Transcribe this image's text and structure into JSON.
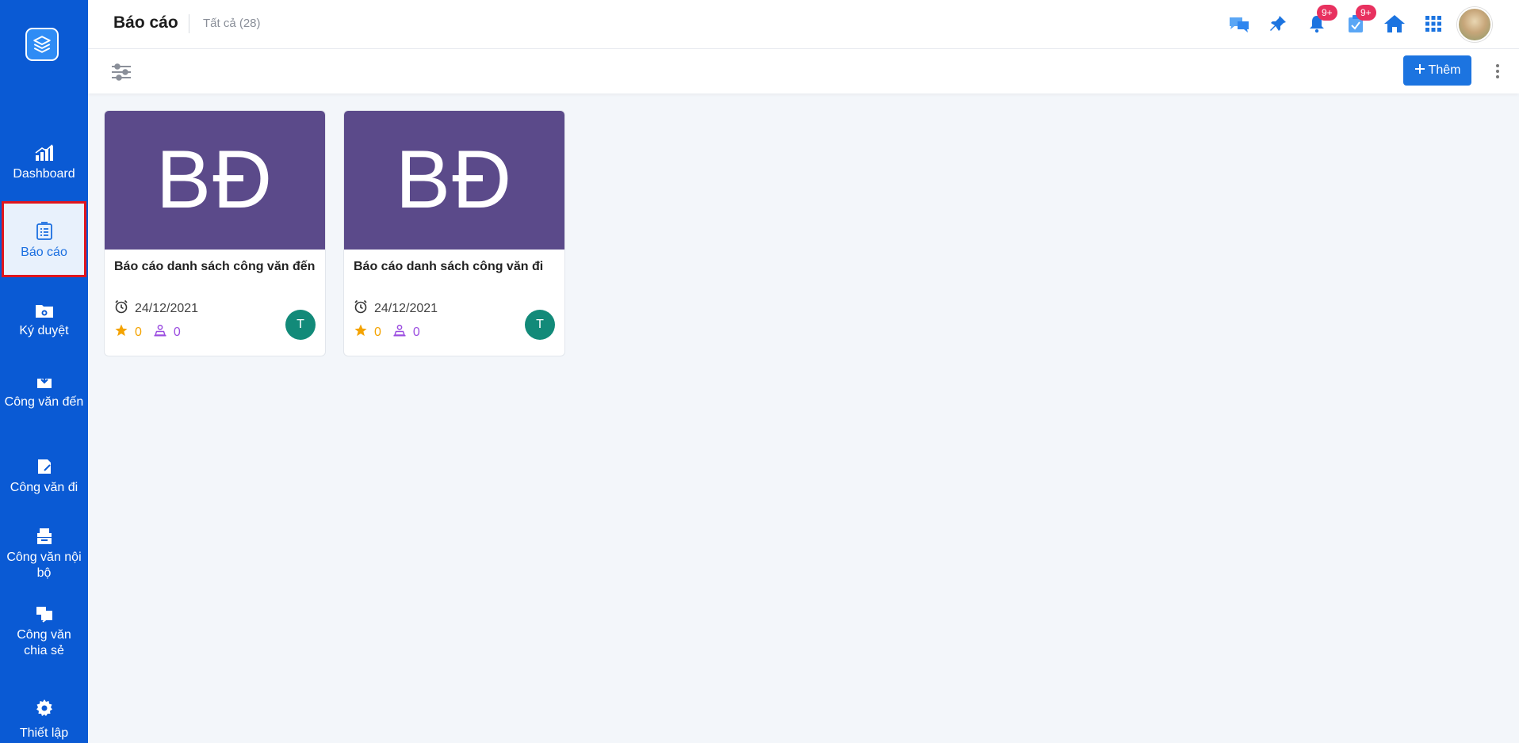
{
  "sidebar": {
    "items": [
      {
        "label": "Dashboard",
        "icon": "chart-bars-icon"
      },
      {
        "label": "Báo cáo",
        "icon": "report-list-icon",
        "active": true
      },
      {
        "label": "Ký duyệt",
        "icon": "sign-folder-icon"
      },
      {
        "label": "Công văn đến",
        "icon": "incoming-doc-icon"
      },
      {
        "label": "Công văn đi",
        "icon": "outgoing-doc-icon"
      },
      {
        "label": "Công văn nội bộ",
        "icon": "internal-doc-icon"
      },
      {
        "label": "Công văn chia sẻ",
        "icon": "shared-doc-icon"
      }
    ],
    "settings_label": "Thiết lập"
  },
  "header": {
    "title": "Báo cáo",
    "count_label": "Tất cả (28)",
    "notification_badge": "9+",
    "task_badge": "9+"
  },
  "toolbar": {
    "add_label": "Thêm"
  },
  "cards": [
    {
      "cover_text": "BĐ",
      "title": "Báo cáo danh sách công văn đến",
      "date": "24/12/2021",
      "stars": "0",
      "shares": "0",
      "avatar_initial": "T"
    },
    {
      "cover_text": "BĐ",
      "title": "Báo cáo danh sách công văn đi",
      "date": "24/12/2021",
      "stars": "0",
      "shares": "0",
      "avatar_initial": "T"
    }
  ],
  "colors": {
    "sidebar_bg": "#0a5ad4",
    "primary": "#1c74e0",
    "card_cover": "#5b4a8a",
    "badge": "#e8315f",
    "avatar": "#128a79",
    "star": "#f4a300",
    "share": "#9b4de0"
  }
}
